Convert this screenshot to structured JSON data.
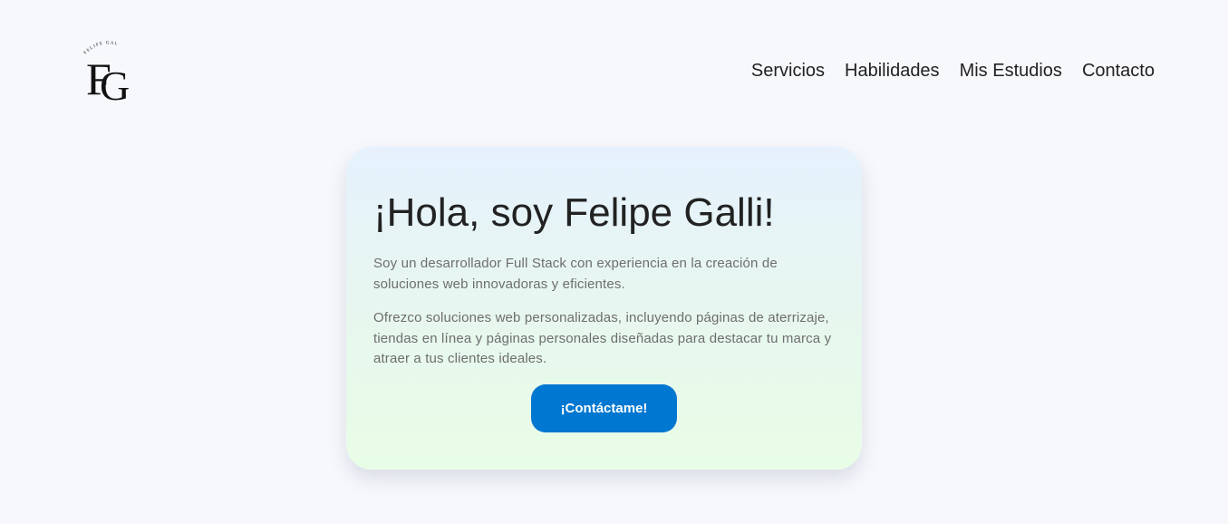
{
  "header": {
    "logo": {
      "monogram": "FG",
      "arc_text": "FELIPE GALLI"
    },
    "nav": {
      "items": [
        {
          "label": "Servicios"
        },
        {
          "label": "Habilidades"
        },
        {
          "label": "Mis Estudios"
        },
        {
          "label": "Contacto"
        }
      ]
    }
  },
  "hero": {
    "title": "¡Hola, soy Felipe Galli!",
    "paragraph_1": "Soy un desarrollador Full Stack con experiencia en la creación de soluciones web innovadoras y eficientes.",
    "paragraph_2": "Ofrezco soluciones web personalizadas, incluyendo páginas de aterrizaje, tiendas en línea y páginas personales diseñadas para destacar tu marca y atraer a tus clientes ideales.",
    "cta_label": "¡Contáctame!"
  },
  "colors": {
    "background": "#f7f8fc",
    "accent": "#0077d0",
    "card_gradient_top": "#e6f1fd",
    "card_gradient_bottom": "#e8fde6",
    "text_dark": "#222222",
    "text_muted": "#6e6e6e"
  }
}
